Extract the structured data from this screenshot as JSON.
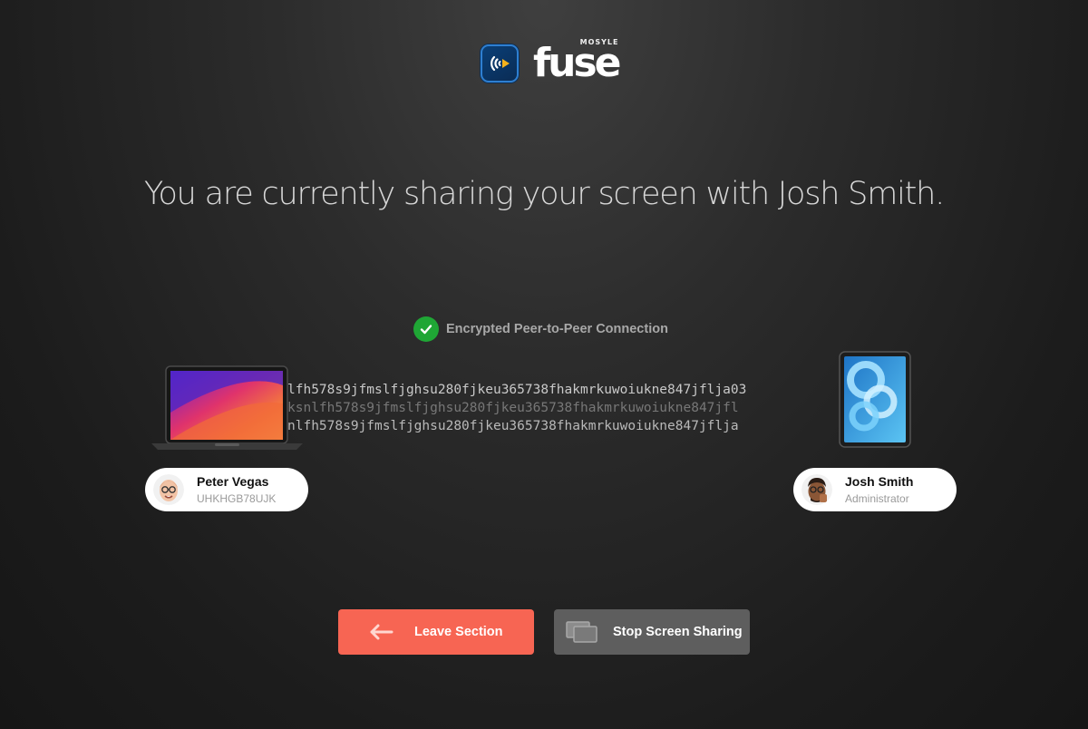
{
  "brand": {
    "small": "MOSYLE",
    "word": "fuse",
    "accent": "#2e7fd1"
  },
  "headline": "You are currently sharing your screen with Josh Smith.",
  "connection": {
    "label": "Encrypted Peer-to-Peer Connection",
    "icon": "check-circle-icon",
    "color": "#1fa635"
  },
  "stream": {
    "lines": [
      "lfh578s9jfmslfjghsu280fjkeu365738fhakmrkuwoiukne847jflja03",
      "ksnlfh578s9jfmslfjghsu280fjkeu365738fhakmrkuwoiukne847jfl",
      "nlfh578s9jfmslfjghsu280fjkeu365738fhakmrkuwoiukne847jflja"
    ]
  },
  "devices": {
    "left": "laptop-icon",
    "right": "tablet-icon"
  },
  "users": {
    "local": {
      "name": "Peter Vegas",
      "id": "UHKHGB78UJK"
    },
    "remote": {
      "name": "Josh Smith",
      "role": "Administrator"
    }
  },
  "buttons": {
    "leave": {
      "label": "Leave Section",
      "icon": "arrow-left-icon",
      "color": "#f76553"
    },
    "stop": {
      "label": "Stop Screen Sharing",
      "icon": "screens-icon",
      "color": "#5e5e5e"
    }
  }
}
